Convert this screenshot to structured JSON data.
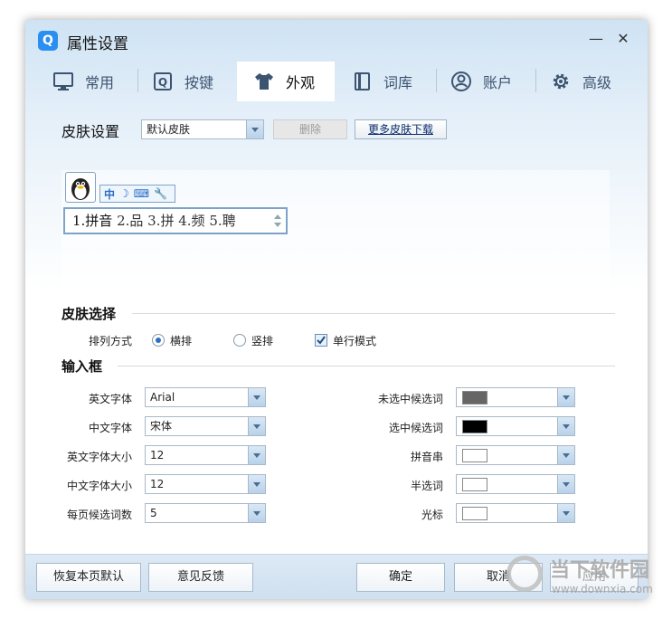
{
  "window": {
    "title": "属性设置",
    "app_icon": "Q",
    "minimize": "—",
    "close": "✕"
  },
  "tabs": [
    {
      "label": "常用",
      "icon": "monitor-icon",
      "active": false
    },
    {
      "label": "按键",
      "icon": "key-icon",
      "active": false
    },
    {
      "label": "外观",
      "icon": "shirt-icon",
      "active": true
    },
    {
      "label": "词库",
      "icon": "book-icon",
      "active": false
    },
    {
      "label": "账户",
      "icon": "user-icon",
      "active": false
    },
    {
      "label": "高级",
      "icon": "gear-icon",
      "active": false
    }
  ],
  "skin_settings": {
    "label": "皮肤设置",
    "current_skin": "默认皮肤",
    "delete_label": "删除",
    "download_label": "更多皮肤下载"
  },
  "preview": {
    "status_chars": [
      "中",
      "☽",
      "⌨",
      "🔧"
    ],
    "candidates_first": "1.拼音",
    "candidates_rest": " 2.品 3.拼 4.频 5.聘"
  },
  "skin_select": {
    "title": "皮肤选择",
    "layout_label": "排列方式",
    "horizontal": "横排",
    "vertical": "竖排",
    "single_line": "单行模式",
    "horizontal_selected": true,
    "single_line_checked": true
  },
  "input_box": {
    "title": "输入框",
    "left_fields": [
      {
        "label": "英文字体",
        "value": "Arial"
      },
      {
        "label": "中文字体",
        "value": "宋体"
      },
      {
        "label": "英文字体大小",
        "value": "12"
      },
      {
        "label": "中文字体大小",
        "value": "12"
      },
      {
        "label": "每页候选词数",
        "value": "5"
      }
    ],
    "right_fields": [
      {
        "label": "未选中候选词",
        "color": "#666666"
      },
      {
        "label": "选中候选词",
        "color": "#000000"
      },
      {
        "label": "拼音串",
        "color": "#ffffff"
      },
      {
        "label": "半选词",
        "color": "#ffffff"
      },
      {
        "label": "光标",
        "color": "#ffffff"
      }
    ]
  },
  "footer": {
    "restore_label": "恢复本页默认",
    "feedback_label": "意见反馈",
    "ok_label": "确定",
    "cancel_label": "取消",
    "apply_label": "应用"
  },
  "watermark": {
    "name": "当下软件园",
    "url": "www.downxia.com"
  }
}
